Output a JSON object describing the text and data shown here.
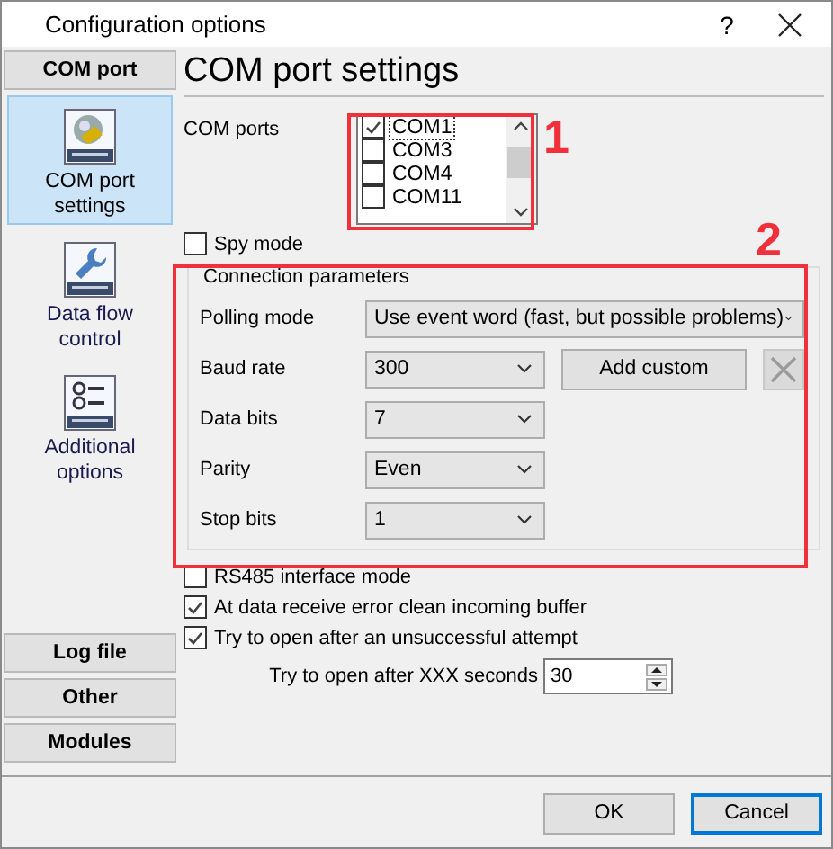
{
  "window": {
    "title": "Configuration options",
    "help": "?"
  },
  "sidebar": {
    "top_sections": [
      {
        "label": "COM port"
      }
    ],
    "items": [
      {
        "label": "COM port settings",
        "kind": "plug",
        "selected": true
      },
      {
        "label": "Data flow control",
        "kind": "wrench",
        "selected": false
      },
      {
        "label": "Additional options",
        "kind": "list",
        "selected": false
      }
    ],
    "bottom_sections": [
      {
        "label": "Log file"
      },
      {
        "label": "Other"
      },
      {
        "label": "Modules"
      }
    ]
  },
  "page": {
    "title": "COM port settings",
    "com_ports": {
      "label": "COM ports",
      "items": [
        {
          "label": "COM1",
          "checked": true,
          "focused": true
        },
        {
          "label": "COM3",
          "checked": false,
          "focused": false
        },
        {
          "label": "COM4",
          "checked": false,
          "focused": false
        },
        {
          "label": "COM11",
          "checked": false,
          "focused": false
        }
      ]
    },
    "spy_mode": {
      "label": "Spy mode",
      "checked": false
    },
    "connection": {
      "title": "Connection parameters",
      "fields": [
        {
          "label": "Polling mode",
          "value": "Use event word (fast, but possible problems)",
          "kind": "wide"
        },
        {
          "label": "Baud rate",
          "value": "300",
          "kind": "custom"
        },
        {
          "label": "Data bits",
          "value": "7",
          "kind": "narrow"
        },
        {
          "label": "Parity",
          "value": "Even",
          "kind": "narrow"
        },
        {
          "label": "Stop bits",
          "value": "1",
          "kind": "narrow"
        }
      ],
      "add_custom": "Add custom",
      "delete_disabled": true
    },
    "options": [
      {
        "label": "RS485 interface mode",
        "checked": false
      },
      {
        "label": "At data receive error clean incoming buffer",
        "checked": true
      },
      {
        "label": "Try to open after an unsuccessful attempt",
        "checked": true
      }
    ],
    "retry": {
      "label": "Try to open after XXX seconds",
      "value": "30"
    }
  },
  "buttons": [
    {
      "label": "OK",
      "focused": false
    },
    {
      "label": "Cancel",
      "focused": true
    }
  ],
  "annotations": [
    {
      "label": "1"
    },
    {
      "label": "2"
    }
  ]
}
